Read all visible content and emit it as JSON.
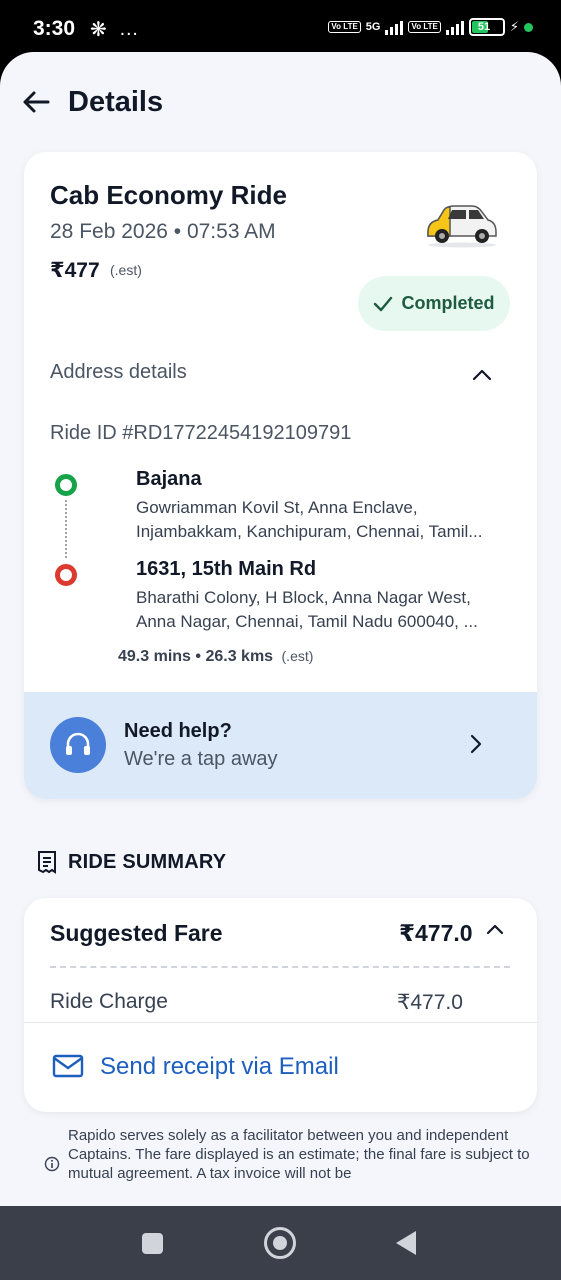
{
  "status_bar": {
    "time": "3:30",
    "misc": "…",
    "network_tag_1": "Vo LTE",
    "network_gen": "5G",
    "network_tag_2": "Vo LTE",
    "battery_level": "51"
  },
  "header": {
    "title": "Details"
  },
  "ride": {
    "title": "Cab Economy Ride",
    "datetime": "28 Feb 2026 • 07:53 AM",
    "price": "₹477",
    "price_note": "(.est)",
    "status": "Completed",
    "vehicle_icon": "taxi-car-icon"
  },
  "address": {
    "section_label": "Address details",
    "ride_id": "Ride ID #RD17722454192109791",
    "pickup": {
      "name": "Bajana",
      "line1": "Gowriamman Kovil St, Anna Enclave,",
      "line2": "Injambakkam, Kanchipuram, Chennai, Tamil..."
    },
    "drop": {
      "name": "1631, 15th Main Rd",
      "line1": "Bharathi Colony, H Block, Anna Nagar West,",
      "line2": "Anna Nagar, Chennai, Tamil Nadu 600040, ..."
    },
    "duration": "49.3 mins",
    "separator": "•",
    "distance": "26.3 kms",
    "stats_note": "(.est)"
  },
  "help": {
    "title": "Need help?",
    "subtitle": "We're a tap away"
  },
  "summary": {
    "heading": "RIDE SUMMARY",
    "fare_label": "Suggested Fare",
    "fare_value": "₹477.0",
    "charge_label": "Ride Charge",
    "charge_value": "₹477.0",
    "email_label": "Send receipt via Email"
  },
  "disclaimer": "Rapido serves solely as a facilitator between you and independent Captains. The fare displayed is an estimate; the final fare is subject to mutual agreement. A tax invoice will not be",
  "colors": {
    "accent_blue": "#1d5fbf",
    "status_green": "#1d5c40",
    "pickup_green": "#16a34a",
    "drop_red": "#dc3a2f",
    "help_bg": "#dce9f8"
  }
}
